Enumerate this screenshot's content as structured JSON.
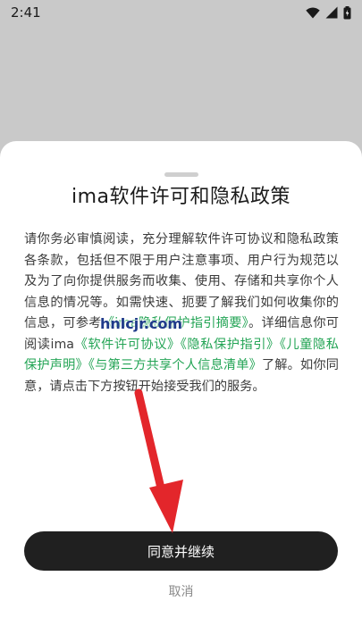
{
  "status_bar": {
    "time": "2:41",
    "icons": [
      "wifi-icon",
      "signal-icon",
      "battery-icon"
    ]
  },
  "dialog": {
    "title": "ima软件许可和隐私政策",
    "body": {
      "part1": "请你务必审慎阅读，充分理解软件许可协议和隐私政策各条款，包括但不限于用户注意事项、用户行为规范以及为了向你提供服务而收集、使用、存储和共享你个人信息的情况等。如需快速、扼要了解我们如何收集你的信息，可参考",
      "link_summary": "《ima隐私保护指引摘要》",
      "part2": "。详细信息你可阅读ima",
      "link_license": "《软件许可协议》",
      "link_privacy": "《隐私保护指引》",
      "link_children": "《儿童隐私保护声明》",
      "link_third_party": "《与第三方共享个人信息清单》",
      "part3": "了解。如你同意，请点击下方按钮开始接受我们的服务。"
    },
    "agree_label": "同意并继续",
    "cancel_label": "取消"
  },
  "watermark": "hnlcjr.com",
  "colors": {
    "accent_link": "#23a455",
    "button_bg": "#202020",
    "annotation_arrow": "#e3262b"
  }
}
